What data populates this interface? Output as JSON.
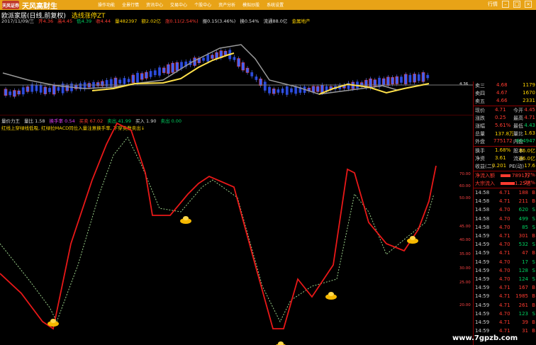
{
  "app": {
    "brand": "天风高财生",
    "brand_badge": "天风证券",
    "menu": [
      "操作功能",
      "全景行情",
      "资讯中心",
      "交易中心",
      "个股中心",
      "资产分析",
      "模拟炒股",
      "系统设置"
    ],
    "top_right": "行情"
  },
  "stock": {
    "code": "欧派家居(日线,前复权)",
    "name": "选线涨停ZT",
    "stats_row": [
      "2017/11/09/三",
      "开4.36",
      "高4.45",
      "低4.39",
      "收4.44",
      "量482397",
      "额2.02亿",
      "涨0.11(2.54%)",
      "振0.15(3.46%)",
      "换0.54%",
      "流通88.0亿",
      "金属地产"
    ]
  },
  "indicator": {
    "row1": [
      "量价力王",
      "量比 1.58",
      "换手率 0.54",
      "买卖 67.02",
      "卖出 41.99",
      "买入 1.90",
      "卖出 0.00"
    ],
    "row2": "红线上穿绿线低吸, 红绿拉MACD同位入量注意换手率, 下穿卖数卖出↓"
  },
  "axis": {
    "price_right": "4.36",
    "osc_ticks": [
      "70.00",
      "60.00",
      "50.00",
      "45.00",
      "40.00",
      "35.00",
      "30.00",
      "25.00",
      "20.00"
    ]
  },
  "panel": {
    "asks": [
      {
        "label": "卖三",
        "price": "4.68",
        "vol": "1179"
      },
      {
        "label": "卖四",
        "price": "4.67",
        "vol": "1670"
      },
      {
        "label": "卖五",
        "price": "4.66",
        "vol": "2331"
      }
    ],
    "quote": [
      {
        "l1": "现价",
        "v1": "4.71",
        "l2": "今开",
        "v2": "4.45"
      },
      {
        "l1": "涨跌",
        "v1": "0.25",
        "l2": "最高",
        "v2": "4.71"
      },
      {
        "l1": "涨幅",
        "v1": "5.61%",
        "l2": "最低",
        "v2": "4.43"
      },
      {
        "l1": "总量",
        "v1": "137.8万",
        "l2": "量比",
        "v2": "1.63"
      },
      {
        "l1": "外盘",
        "v1": "775172",
        "l2": "内盘",
        "v2": "604947"
      }
    ],
    "fund": [
      {
        "l1": "换手",
        "v1": "1.68%",
        "l2": "股本",
        "v2": "86.0亿"
      },
      {
        "l1": "净资",
        "v1": "3.61",
        "l2": "流通",
        "v2": "86.0亿"
      },
      {
        "l1": "收益(二)",
        "v1": "0.201",
        "l2": "PE(动)",
        "v2": "17.6"
      }
    ],
    "flows": [
      {
        "label": "净流入额",
        "value": "7891万",
        "pct": "12%"
      },
      {
        "label": "大宗流入",
        "value": "1.25亿",
        "pct": "28%"
      }
    ],
    "ticks": [
      {
        "t": "14:58",
        "p": "4.71",
        "v": "188",
        "d": "B"
      },
      {
        "t": "14:58",
        "p": "4.71",
        "v": "211",
        "d": "B"
      },
      {
        "t": "14:58",
        "p": "4.70",
        "v": "620",
        "d": "S"
      },
      {
        "t": "14:58",
        "p": "4.70",
        "v": "499",
        "d": "S"
      },
      {
        "t": "14:58",
        "p": "4.70",
        "v": "85",
        "d": "S"
      },
      {
        "t": "14:59",
        "p": "4.71",
        "v": "301",
        "d": "B"
      },
      {
        "t": "14:59",
        "p": "4.70",
        "v": "532",
        "d": "S"
      },
      {
        "t": "14:59",
        "p": "4.71",
        "v": "47",
        "d": "B"
      },
      {
        "t": "14:59",
        "p": "4.70",
        "v": "17",
        "d": "S"
      },
      {
        "t": "14:59",
        "p": "4.70",
        "v": "128",
        "d": "S"
      },
      {
        "t": "14:59",
        "p": "4.70",
        "v": "124",
        "d": "S"
      },
      {
        "t": "14:59",
        "p": "4.71",
        "v": "167",
        "d": "B"
      },
      {
        "t": "14:59",
        "p": "4.71",
        "v": "1985",
        "d": "B"
      },
      {
        "t": "14:59",
        "p": "4.71",
        "v": "261",
        "d": "B"
      },
      {
        "t": "14:59",
        "p": "4.70",
        "v": "123",
        "d": "S"
      },
      {
        "t": "14:59",
        "p": "4.71",
        "v": "39",
        "d": "B"
      },
      {
        "t": "14:59",
        "p": "4.71",
        "v": "31",
        "d": "B"
      }
    ]
  },
  "watermark": "www.7gpzb.com",
  "colors": {
    "red": "#ff3b30",
    "green": "#00d060",
    "yellow": "#ffd400",
    "blue": "#2f5bff",
    "oscRed": "#e81818",
    "oscGreen": "#9bd08a"
  }
}
